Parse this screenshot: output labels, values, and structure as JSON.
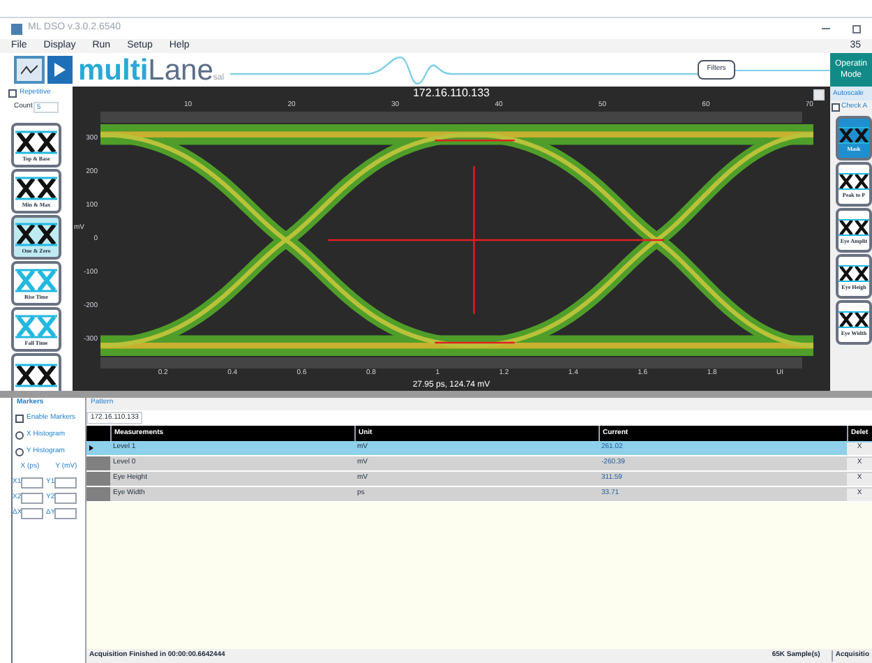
{
  "window": {
    "title": "ML DSO v.3.0.2.6540",
    "corner": "35"
  },
  "menu": [
    "File",
    "Display",
    "Run",
    "Setup",
    "Help"
  ],
  "logo": {
    "brand_a": "multi",
    "brand_b": "Lane",
    "suffix": "sal"
  },
  "filters_button": "Filters",
  "acquisition": {
    "repetitive": {
      "label": "Repetitive",
      "checked": false
    },
    "count": {
      "label": "Count",
      "value": "5"
    }
  },
  "left_tools": [
    {
      "label": "Top & Base",
      "selected": false
    },
    {
      "label": "Min & Max",
      "selected": false
    },
    {
      "label": "One & Zero",
      "selected": true
    },
    {
      "label": "Rise Time",
      "selected": false
    },
    {
      "label": "Fall Time",
      "selected": false
    },
    {
      "selected": false
    }
  ],
  "plot": {
    "title": "172.16.110.133",
    "top_ticks": [
      "10",
      "20",
      "30",
      "40",
      "50",
      "60",
      "70"
    ],
    "y_ticks": [
      "300",
      "200",
      "100",
      "0",
      "-100",
      "-200",
      "-300"
    ],
    "y_unit": "mV",
    "x_ticks": [
      "0.2",
      "0.4",
      "0.6",
      "0.8",
      "1",
      "1.2",
      "1.4",
      "1.6",
      "1.8"
    ],
    "x_unit": "UI",
    "readout": "27.95 ps, 124.74 mV"
  },
  "right_panel": {
    "mode_button": [
      "Operatin",
      "Mode"
    ],
    "tab": "Autoscale",
    "check": {
      "label": "Check A",
      "checked": false
    },
    "tools": [
      {
        "label": "Mask",
        "selected": true
      },
      {
        "label": "Peak to P",
        "selected": false
      },
      {
        "label": "Eye Amplit",
        "selected": false
      },
      {
        "label": "Eye Heigh",
        "selected": false
      },
      {
        "label": "Eye Width",
        "selected": false
      }
    ]
  },
  "bottom_tabs": [
    {
      "label": "Markers",
      "selected": true
    },
    {
      "label": "Pattern",
      "selected": false
    }
  ],
  "markers": {
    "enable": {
      "label": "Enable Markers",
      "checked": false
    },
    "histograms": [
      {
        "label": "X Histogram",
        "selected": false
      },
      {
        "label": "Y Histogram",
        "selected": false
      }
    ],
    "x_header": "X (ps)",
    "y_header": "Y (mV)",
    "fields": [
      [
        "X1",
        "Y1"
      ],
      [
        "X2",
        "Y2"
      ],
      [
        "ΔX",
        "ΔY"
      ]
    ]
  },
  "pattern_source": "172.16.110.133",
  "table": {
    "columns": [
      "Measurements",
      "Unit",
      "Current",
      "Delet"
    ],
    "rows": [
      {
        "cells": [
          "Level 1",
          "mV",
          "261.02"
        ],
        "delete": "X",
        "selected": true
      },
      {
        "cells": [
          "Level 0",
          "mV",
          "-260.39"
        ],
        "delete": "X",
        "selected": false
      },
      {
        "cells": [
          "Eye Height",
          "mV",
          "311.59"
        ],
        "delete": "X",
        "selected": false
      },
      {
        "cells": [
          "Eye Width",
          "ps",
          "33.71"
        ],
        "delete": "X",
        "selected": false
      }
    ]
  },
  "status_bar": {
    "message": "Acquisition Finished in 00:00:00.6642444",
    "samples": "65K Sample(s)",
    "right": "Acquisitio"
  }
}
